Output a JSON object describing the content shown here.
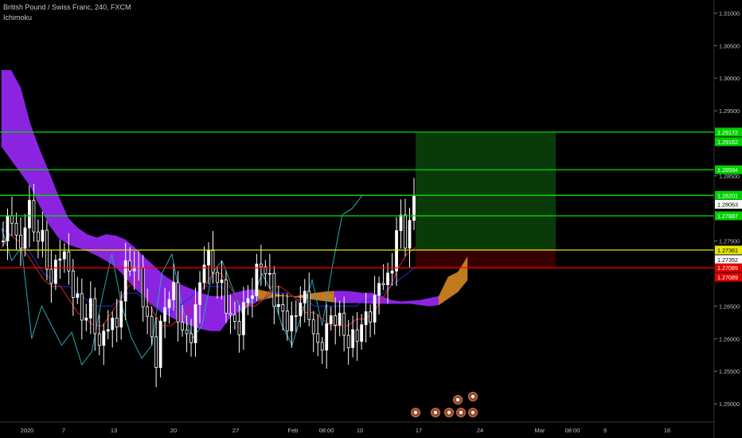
{
  "header": {
    "symbol_line": "British Pound / Swiss Franc, 240, FXCM",
    "indicator": "Ichimoku"
  },
  "colors": {
    "background": "#000000",
    "candle": "#ffffff",
    "tenkan": "#e02020",
    "kijun": "#2233cc",
    "chikou": "#26a9b5",
    "cloud_bear": "#8a24e0",
    "cloud_bull": "#c27a1e",
    "support": "#ff0000",
    "entry": "#e8e800",
    "target": "#00e000",
    "profit_zone": "#0b3d0b",
    "loss_zone": "#3a0000"
  },
  "chart_data": {
    "type": "candlestick",
    "symbol": "GBPCHF",
    "timeframe": "240",
    "ylim": [
      1.2472,
      1.312
    ],
    "y_ticks": [
      "1.31000",
      "1.30500",
      "1.30000",
      "1.29500",
      "1.28500",
      "1.27500",
      "1.26500",
      "1.26000",
      "1.25500",
      "1.25000"
    ],
    "x_ticks": [
      "2020",
      "7",
      "13",
      "20",
      "27",
      "Feb",
      "08:00",
      "10",
      "17",
      "24",
      "Mar",
      "08:00",
      "9",
      "16"
    ],
    "price_labels": [
      {
        "text": "1.29172",
        "value": 1.29172,
        "color": "#00d000"
      },
      {
        "text": "1.29162",
        "value": 1.29025,
        "color": "#00d000"
      },
      {
        "text": "1.28594",
        "value": 1.28594,
        "color": "#00d000"
      },
      {
        "text": "1.28201",
        "value": 1.28201,
        "color": "#00d000"
      },
      {
        "text": "1.28063",
        "value": 1.28063,
        "color": "#ffffff"
      },
      {
        "text": "1.27887",
        "value": 1.27887,
        "color": "#00d000"
      },
      {
        "text": "1.27361",
        "value": 1.27361,
        "color": "#e8e800"
      },
      {
        "text": "1.27352",
        "value": 1.27215,
        "color": "#ffffff"
      },
      {
        "text": "1.27089",
        "value": 1.27089,
        "color": "#e00000"
      },
      {
        "text": "1.27089",
        "value": 1.26945,
        "color": "#e00000"
      }
    ],
    "horizontal_lines": [
      {
        "value": 1.29172,
        "color": "#00e000"
      },
      {
        "value": 1.28594,
        "color": "#00e000"
      },
      {
        "value": 1.28201,
        "color": "#00e000"
      },
      {
        "value": 1.27887,
        "color": "#00e000"
      },
      {
        "value": 1.27361,
        "color": "#e8e800"
      },
      {
        "value": 1.27089,
        "color": "#ff0000"
      }
    ],
    "position_tool": {
      "entry": 1.27361,
      "target": 1.29172,
      "stop": 1.27089
    },
    "close_series": [
      1.275,
      1.28,
      1.272,
      1.281,
      1.276,
      1.275,
      1.268,
      1.274,
      1.271,
      1.266,
      1.263,
      1.265,
      1.258,
      1.263,
      1.261,
      1.27,
      1.272,
      1.269,
      1.262,
      1.257,
      1.265,
      1.268,
      1.262,
      1.259,
      1.265,
      1.273,
      1.271,
      1.268,
      1.264,
      1.261,
      1.265,
      1.268,
      1.272,
      1.269,
      1.265,
      1.263,
      1.262,
      1.267,
      1.264,
      1.258,
      1.261,
      1.264,
      1.262,
      1.259,
      1.261,
      1.263,
      1.265,
      1.27,
      1.268,
      1.279,
      1.275,
      1.281
    ],
    "chikou_series": [
      1.277,
      1.272,
      1.274,
      1.26,
      1.265,
      1.262,
      1.259,
      1.261,
      1.256,
      1.258,
      1.266,
      1.273,
      1.265,
      1.26,
      1.257,
      1.259,
      1.27,
      1.273,
      1.265,
      1.26,
      1.262,
      1.27,
      1.272,
      1.268,
      1.264,
      1.266,
      1.27,
      1.267,
      1.262,
      1.259,
      1.264,
      1.269,
      1.262,
      1.271,
      1.279,
      1.28,
      1.282
    ],
    "tenkan_series": [
      1.274,
      1.276,
      1.275,
      1.273,
      1.271,
      1.269,
      1.268,
      1.268,
      1.266,
      1.264,
      1.263,
      1.262,
      1.262,
      1.264,
      1.266,
      1.268,
      1.269,
      1.267,
      1.264,
      1.262,
      1.262,
      1.263,
      1.264,
      1.266,
      1.268,
      1.27,
      1.27,
      1.268,
      1.266,
      1.265,
      1.265,
      1.266,
      1.268,
      1.268,
      1.267,
      1.266,
      1.264,
      1.264,
      1.263,
      1.262,
      1.262,
      1.262,
      1.263,
      1.263,
      1.264,
      1.266,
      1.268,
      1.271,
      1.273,
      1.274
    ],
    "kijun_series": [
      1.277,
      1.276,
      1.275,
      1.274,
      1.272,
      1.27,
      1.269,
      1.268,
      1.268,
      1.267,
      1.266,
      1.265,
      1.265,
      1.265,
      1.266,
      1.267,
      1.267,
      1.266,
      1.265,
      1.264,
      1.264,
      1.265,
      1.266,
      1.267,
      1.268,
      1.268,
      1.268,
      1.267,
      1.266,
      1.266,
      1.266,
      1.266,
      1.267,
      1.267,
      1.267,
      1.266,
      1.266,
      1.265,
      1.265,
      1.265,
      1.265,
      1.265,
      1.265,
      1.266,
      1.266,
      1.267,
      1.268,
      1.269,
      1.27,
      1.271
    ],
    "cloud_upper": [
      1.3012,
      1.3012,
      1.2985,
      1.293,
      1.289,
      1.2855,
      1.2818,
      1.2785,
      1.277,
      1.276,
      1.2755,
      1.276,
      1.2758,
      1.2752,
      1.274,
      1.2725,
      1.2712,
      1.2698,
      1.2688,
      1.2682,
      1.2676,
      1.267,
      1.2665,
      1.2665,
      1.2668,
      1.2672,
      1.2675,
      1.2675,
      1.2672,
      1.2668,
      1.2665,
      1.2665,
      1.2668,
      1.267,
      1.2672,
      1.2673,
      1.2673,
      1.2672,
      1.267,
      1.267,
      1.2665,
      1.2659,
      1.2657,
      1.2658,
      1.2659,
      1.2662,
      1.2665,
      1.2695,
      1.2702,
      1.2725
    ],
    "cloud_lower": [
      1.2895,
      1.2875,
      1.2855,
      1.2835,
      1.2805,
      1.2775,
      1.2755,
      1.2745,
      1.274,
      1.2735,
      1.2728,
      1.272,
      1.271,
      1.2695,
      1.2678,
      1.2665,
      1.265,
      1.264,
      1.2632,
      1.2625,
      1.262,
      1.2615,
      1.2612,
      1.2612,
      1.2632,
      1.2642,
      1.265,
      1.2658,
      1.2662,
      1.2665,
      1.2666,
      1.2664,
      1.2662,
      1.266,
      1.2658,
      1.2656,
      1.2655,
      1.2655,
      1.2655,
      1.2654,
      1.2654,
      1.2654,
      1.2654,
      1.2654,
      1.2652,
      1.265,
      1.2652,
      1.2662,
      1.2672,
      1.269
    ],
    "event_markers": 7
  }
}
